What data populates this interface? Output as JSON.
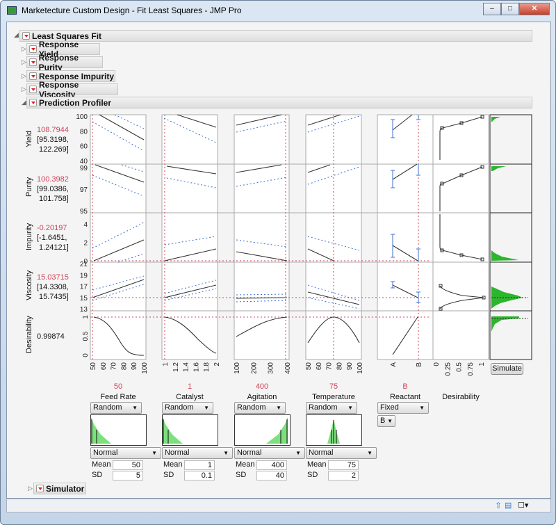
{
  "window": {
    "title": "Marketecture Custom Design - Fit Least Squares - JMP Pro",
    "minimize": "–",
    "maximize": "□",
    "close": "✕"
  },
  "outline": {
    "root": "Least Squares Fit",
    "items": [
      "Response Yield",
      "Response Purity",
      "Response Impurity",
      "Response Viscosity",
      "Prediction Profiler"
    ],
    "simulator": "Simulator"
  },
  "responses": [
    {
      "name": "Yield",
      "value": "108.7944",
      "ci": [
        "[95.3198,",
        "122.269]"
      ],
      "ticks": [
        40,
        60,
        80,
        100
      ],
      "range": [
        40,
        100
      ]
    },
    {
      "name": "Purity",
      "value": "100.3982",
      "ci": [
        "[99.0386,",
        "101.758]"
      ],
      "ticks": [
        95,
        97,
        99
      ],
      "range": [
        95,
        99
      ]
    },
    {
      "name": "Impurity",
      "value": "-0.20197",
      "ci": [
        "[-1.6451,",
        "1.24121]"
      ],
      "ticks": [
        0,
        2,
        4
      ],
      "range": [
        0,
        4
      ]
    },
    {
      "name": "Viscosity",
      "value": "15.03715",
      "ci": [
        "[14.3308,",
        "15.7435]"
      ],
      "ticks": [
        13,
        15,
        17,
        19,
        21
      ],
      "range": [
        13,
        21
      ]
    },
    {
      "name": "Desirability",
      "value": "0.99874",
      "ci": [],
      "ticks": [
        0,
        0.5,
        1
      ],
      "range": [
        0,
        1
      ]
    }
  ],
  "factors": [
    {
      "name": "Feed Rate",
      "current": "50",
      "ticks": [
        "50",
        "60",
        "70",
        "80",
        "90",
        "100"
      ],
      "range": [
        50,
        100
      ],
      "mode": "Random",
      "dist": "Normal",
      "mean_label": "Mean",
      "mean": "50",
      "sd_label": "SD",
      "sd": "5"
    },
    {
      "name": "Catalyst",
      "current": "1",
      "ticks": [
        "1",
        "1.2",
        "1.4",
        "1.6",
        "1.8",
        "2"
      ],
      "range": [
        1,
        2
      ],
      "mode": "Random",
      "dist": "Normal",
      "mean_label": "Mean",
      "mean": "1",
      "sd_label": "SD",
      "sd": "0.1"
    },
    {
      "name": "Agitation",
      "current": "400",
      "ticks": [
        "100",
        "200",
        "300",
        "400"
      ],
      "range": [
        100,
        400
      ],
      "mode": "Random",
      "dist": "Normal",
      "mean_label": "Mean",
      "mean": "400",
      "sd_label": "SD",
      "sd": "40"
    },
    {
      "name": "Temperature",
      "current": "75",
      "ticks": [
        "50",
        "60",
        "70",
        "80",
        "90",
        "100"
      ],
      "range": [
        50,
        100
      ],
      "mode": "Random",
      "dist": "Normal",
      "mean_label": "Mean",
      "mean": "75",
      "sd_label": "SD",
      "sd": "2"
    }
  ],
  "reactant": {
    "name": "Reactant",
    "current": "B",
    "ticks": [
      "A",
      "B"
    ],
    "mode": "Fixed",
    "level": "B"
  },
  "desirability": {
    "name": "Desirability",
    "ticks": [
      "0",
      "0.25",
      "0.5",
      "0.75",
      "1"
    ]
  },
  "simulate_label": "Simulate",
  "colors": {
    "current": "#d0445a",
    "ci": "#3b6fd0",
    "hist": "#2db52d"
  }
}
